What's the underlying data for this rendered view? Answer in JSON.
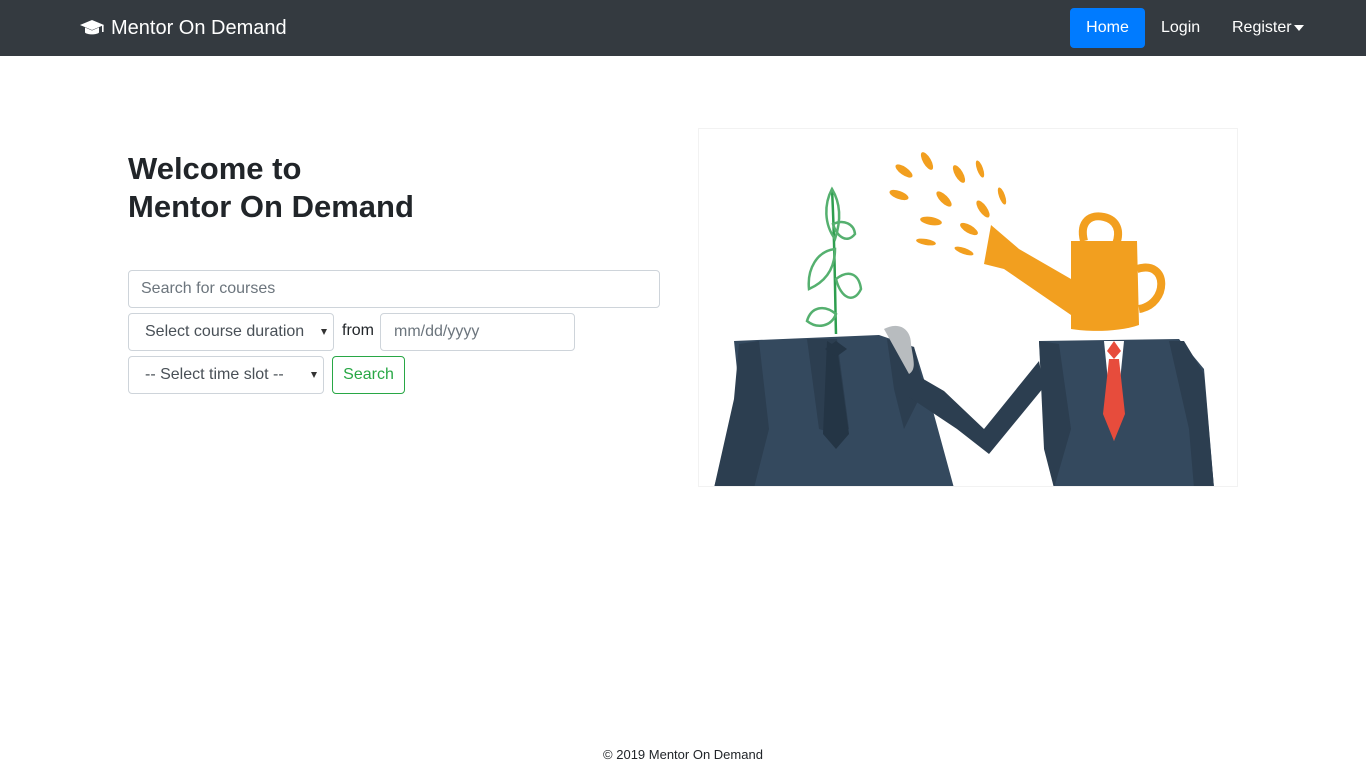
{
  "navbar": {
    "brand": "Mentor On Demand",
    "brand_icon": "graduation-cap-icon",
    "links": {
      "home": "Home",
      "login": "Login",
      "register": "Register"
    },
    "active_color": "#007bff",
    "bg_color": "#343a40"
  },
  "hero": {
    "title_line1": "Welcome to",
    "title_line2": "Mentor On Demand"
  },
  "search": {
    "placeholder": "Search for courses",
    "duration_selected": "Select course duration",
    "from_label": "from",
    "date_placeholder": "mm/dd/yyyy",
    "timeslot_selected": "-- Select time slot --",
    "button_label": "Search",
    "button_color": "#28a745"
  },
  "footer": {
    "copyright": "© 2019 Mentor On Demand"
  }
}
